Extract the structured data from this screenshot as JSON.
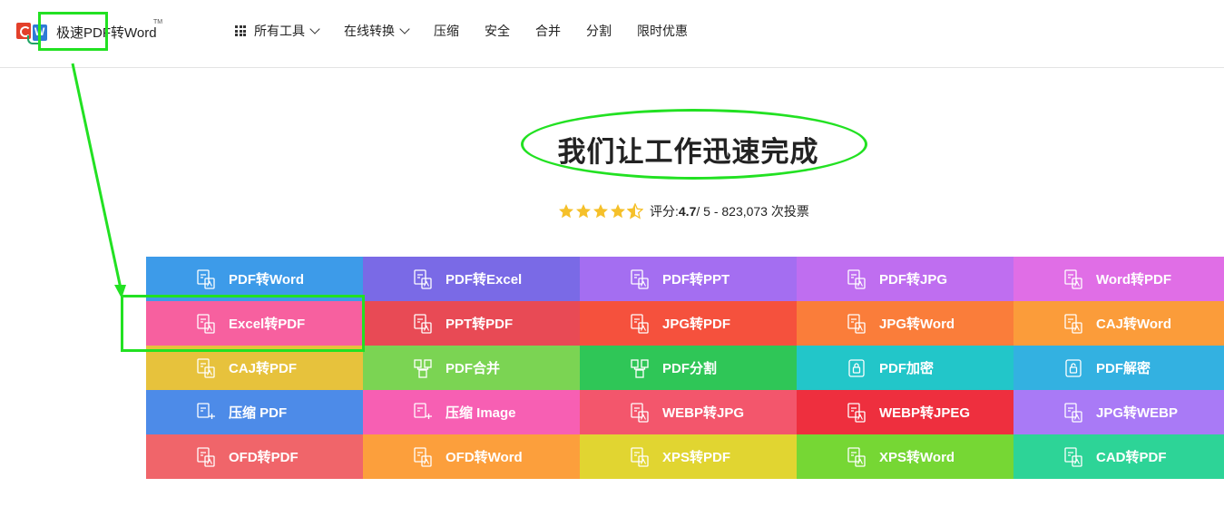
{
  "header": {
    "logo_text": "极速PDF转Word",
    "tm": "TM",
    "nav": [
      {
        "label": "所有工具",
        "has_grid_icon": true,
        "has_chevron": true
      },
      {
        "label": "在线转换",
        "has_grid_icon": false,
        "has_chevron": true
      },
      {
        "label": "压缩"
      },
      {
        "label": "安全"
      },
      {
        "label": "合并"
      },
      {
        "label": "分割"
      },
      {
        "label": "限时优惠"
      }
    ]
  },
  "hero": {
    "title": "我们让工作迅速完成"
  },
  "rating": {
    "stars": 4.5,
    "prefix": "评分: ",
    "score": "4.7",
    "suffix": " / 5 - 823,073 次投票",
    "star_color": "#f5c02a"
  },
  "tools": [
    {
      "label": "PDF转Word",
      "color": "#3d9be9",
      "icon": "pdf-to-word-icon"
    },
    {
      "label": "PDF转Excel",
      "color": "#7a6ae6",
      "icon": "pdf-to-excel-icon"
    },
    {
      "label": "PDF转PPT",
      "color": "#a46ef1",
      "icon": "pdf-to-ppt-icon"
    },
    {
      "label": "PDF转JPG",
      "color": "#bf6ef0",
      "icon": "pdf-to-jpg-icon"
    },
    {
      "label": "Word转PDF",
      "color": "#e06ee6",
      "icon": "word-to-pdf-icon"
    },
    {
      "label": "Excel转PDF",
      "color": "#f7609f",
      "icon": "excel-to-pdf-icon"
    },
    {
      "label": "PPT转PDF",
      "color": "#e84a55",
      "icon": "ppt-to-pdf-icon"
    },
    {
      "label": "JPG转PDF",
      "color": "#f5513d",
      "icon": "jpg-to-pdf-icon"
    },
    {
      "label": "JPG转Word",
      "color": "#fa7d3a",
      "icon": "jpg-to-word-icon"
    },
    {
      "label": "CAJ转Word",
      "color": "#fb9c3a",
      "icon": "caj-to-word-icon"
    },
    {
      "label": "CAJ转PDF",
      "color": "#e7c23c",
      "icon": "caj-to-pdf-icon"
    },
    {
      "label": "PDF合并",
      "color": "#7bd453",
      "icon": "pdf-merge-icon"
    },
    {
      "label": "PDF分割",
      "color": "#2fc657",
      "icon": "pdf-split-icon"
    },
    {
      "label": "PDF加密",
      "color": "#22c6c9",
      "icon": "pdf-encrypt-icon"
    },
    {
      "label": "PDF解密",
      "color": "#33b1e1",
      "icon": "pdf-decrypt-icon"
    },
    {
      "label": "压缩 PDF",
      "color": "#4d8be8",
      "icon": "compress-pdf-icon"
    },
    {
      "label": "压缩 Image",
      "color": "#f75fb3",
      "icon": "compress-image-icon"
    },
    {
      "label": "WEBP转JPG",
      "color": "#f3566c",
      "icon": "webp-to-jpg-icon"
    },
    {
      "label": "WEBP转JPEG",
      "color": "#ee2f3e",
      "icon": "webp-to-jpeg-icon"
    },
    {
      "label": "JPG转WEBP",
      "color": "#a97af6",
      "icon": "jpg-to-webp-icon"
    },
    {
      "label": "OFD转PDF",
      "color": "#f0656a",
      "icon": "ofd-to-pdf-icon"
    },
    {
      "label": "OFD转Word",
      "color": "#fc9f3c",
      "icon": "ofd-to-word-icon"
    },
    {
      "label": "XPS转PDF",
      "color": "#e1d531",
      "icon": "xps-to-pdf-icon"
    },
    {
      "label": "XPS转Word",
      "color": "#76d734",
      "icon": "xps-to-word-icon"
    },
    {
      "label": "CAD转PDF",
      "color": "#2dd497",
      "icon": "cad-to-pdf-icon"
    }
  ],
  "annotation_color": "#22e122"
}
